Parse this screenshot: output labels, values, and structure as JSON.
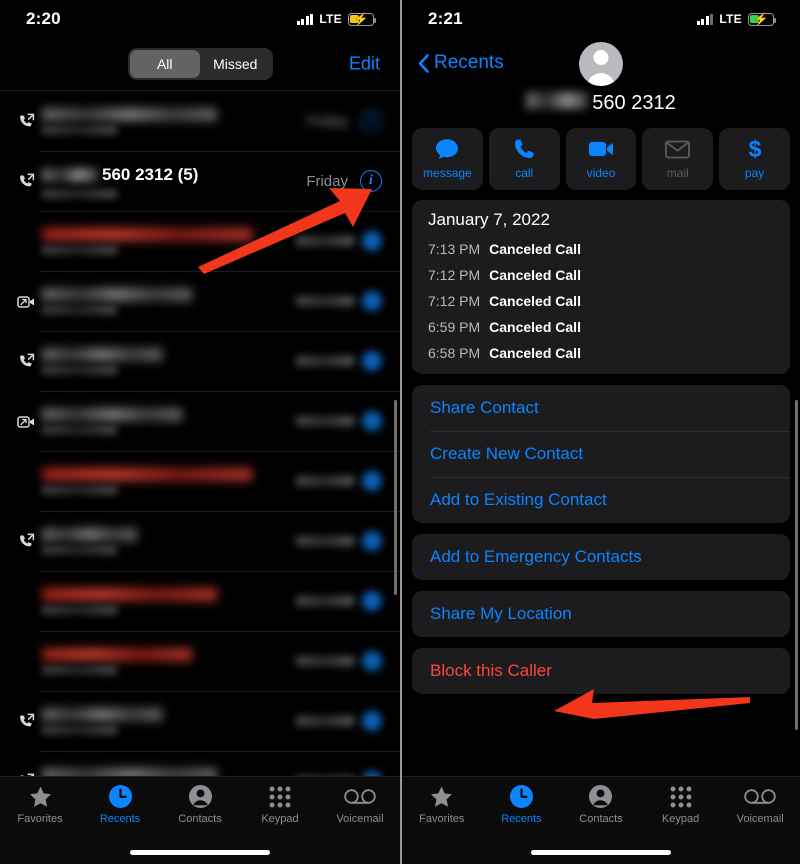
{
  "left": {
    "status": {
      "time": "2:20",
      "network": "LTE",
      "battery_color": "#f5c518",
      "signal_bars": 4
    },
    "header": {
      "segments": [
        {
          "label": "All",
          "active": true
        },
        {
          "label": "Missed",
          "active": false
        }
      ],
      "edit_label": "Edit"
    },
    "calls": [
      {
        "redacted": true,
        "name": "",
        "icon": "outgoing-call-icon",
        "when": "Friday",
        "style": "grey",
        "bar": "w1",
        "sub": true,
        "info": true
      },
      {
        "redacted": false,
        "name": "560 2312 (5)",
        "icon": "outgoing-call-icon",
        "when": "Friday",
        "style": "grey",
        "sub": true,
        "info": true
      },
      {
        "redacted": true,
        "name": "",
        "icon": "none",
        "when": "",
        "style": "red",
        "bar": "w4",
        "sub": true,
        "info": true
      },
      {
        "redacted": true,
        "name": "",
        "icon": "video-call-icon",
        "when": "",
        "style": "grey",
        "bar": "w5",
        "sub": true,
        "info": true
      },
      {
        "redacted": true,
        "name": "",
        "icon": "outgoing-call-icon",
        "when": "",
        "style": "grey",
        "bar": "w2",
        "sub": true,
        "info": true
      },
      {
        "redacted": true,
        "name": "",
        "icon": "video-call-icon",
        "when": "",
        "style": "grey",
        "bar": "w6",
        "sub": true,
        "info": true
      },
      {
        "redacted": true,
        "name": "",
        "icon": "none",
        "when": "",
        "style": "red",
        "bar": "w4",
        "sub": true,
        "info": true
      },
      {
        "redacted": true,
        "name": "",
        "icon": "outgoing-call-icon",
        "when": "",
        "style": "grey",
        "bar": "w3",
        "sub": true,
        "info": true
      },
      {
        "redacted": true,
        "name": "",
        "icon": "none",
        "when": "",
        "style": "red",
        "bar": "w1",
        "sub": true,
        "info": true
      },
      {
        "redacted": true,
        "name": "",
        "icon": "none",
        "when": "",
        "style": "red",
        "bar": "w5",
        "sub": true,
        "info": true
      },
      {
        "redacted": true,
        "name": "",
        "icon": "outgoing-call-icon",
        "when": "",
        "style": "grey",
        "bar": "w2",
        "sub": true,
        "info": true
      },
      {
        "redacted": true,
        "name": "",
        "icon": "outgoing-call-icon",
        "when": "",
        "style": "grey",
        "bar": "w1",
        "sub": true,
        "info": true
      }
    ],
    "tabs": [
      {
        "label": "Favorites",
        "icon": "star-icon",
        "active": false
      },
      {
        "label": "Recents",
        "icon": "clock-icon",
        "active": true
      },
      {
        "label": "Contacts",
        "icon": "person-icon",
        "active": false
      },
      {
        "label": "Keypad",
        "icon": "keypad-icon",
        "active": false
      },
      {
        "label": "Voicemail",
        "icon": "voicemail-icon",
        "active": false
      }
    ]
  },
  "right": {
    "status": {
      "time": "2:21",
      "network": "LTE",
      "battery_color": "#32d74b",
      "signal_bars": 3
    },
    "nav": {
      "back_label": "Recents"
    },
    "contact": {
      "number": "560 2312",
      "avatar": "person-placeholder-avatar"
    },
    "actions": [
      {
        "label": "message",
        "icon": "message-bubble-icon",
        "disabled": false
      },
      {
        "label": "call",
        "icon": "phone-icon",
        "disabled": false
      },
      {
        "label": "video",
        "icon": "video-camera-icon",
        "disabled": false
      },
      {
        "label": "mail",
        "icon": "envelope-icon",
        "disabled": true
      },
      {
        "label": "pay",
        "icon": "dollar-icon",
        "disabled": false
      }
    ],
    "history": {
      "date": "January 7, 2022",
      "entries": [
        {
          "time": "7:13 PM",
          "type": "Canceled Call"
        },
        {
          "time": "7:12 PM",
          "type": "Canceled Call"
        },
        {
          "time": "7:12 PM",
          "type": "Canceled Call"
        },
        {
          "time": "6:59 PM",
          "type": "Canceled Call"
        },
        {
          "time": "6:58 PM",
          "type": "Canceled Call"
        }
      ]
    },
    "menu_groups": [
      {
        "items": [
          {
            "label": "Share Contact",
            "destructive": false
          },
          {
            "label": "Create New Contact",
            "destructive": false
          },
          {
            "label": "Add to Existing Contact",
            "destructive": false
          }
        ]
      },
      {
        "items": [
          {
            "label": "Add to Emergency Contacts",
            "destructive": false
          }
        ]
      },
      {
        "items": [
          {
            "label": "Share My Location",
            "destructive": false
          }
        ]
      },
      {
        "items": [
          {
            "label": "Block this Caller",
            "destructive": true
          }
        ]
      }
    ],
    "tabs": [
      {
        "label": "Favorites",
        "icon": "star-icon",
        "active": false
      },
      {
        "label": "Recents",
        "icon": "clock-icon",
        "active": true
      },
      {
        "label": "Contacts",
        "icon": "person-icon",
        "active": false
      },
      {
        "label": "Keypad",
        "icon": "keypad-icon",
        "active": false
      },
      {
        "label": "Voicemail",
        "icon": "voicemail-icon",
        "active": false
      }
    ]
  },
  "annotations": {
    "arrow_color": "#f1361b",
    "arrow_left_target": "info-button-of-560-2312-row",
    "arrow_right_target": "block-this-caller-menu-item"
  }
}
